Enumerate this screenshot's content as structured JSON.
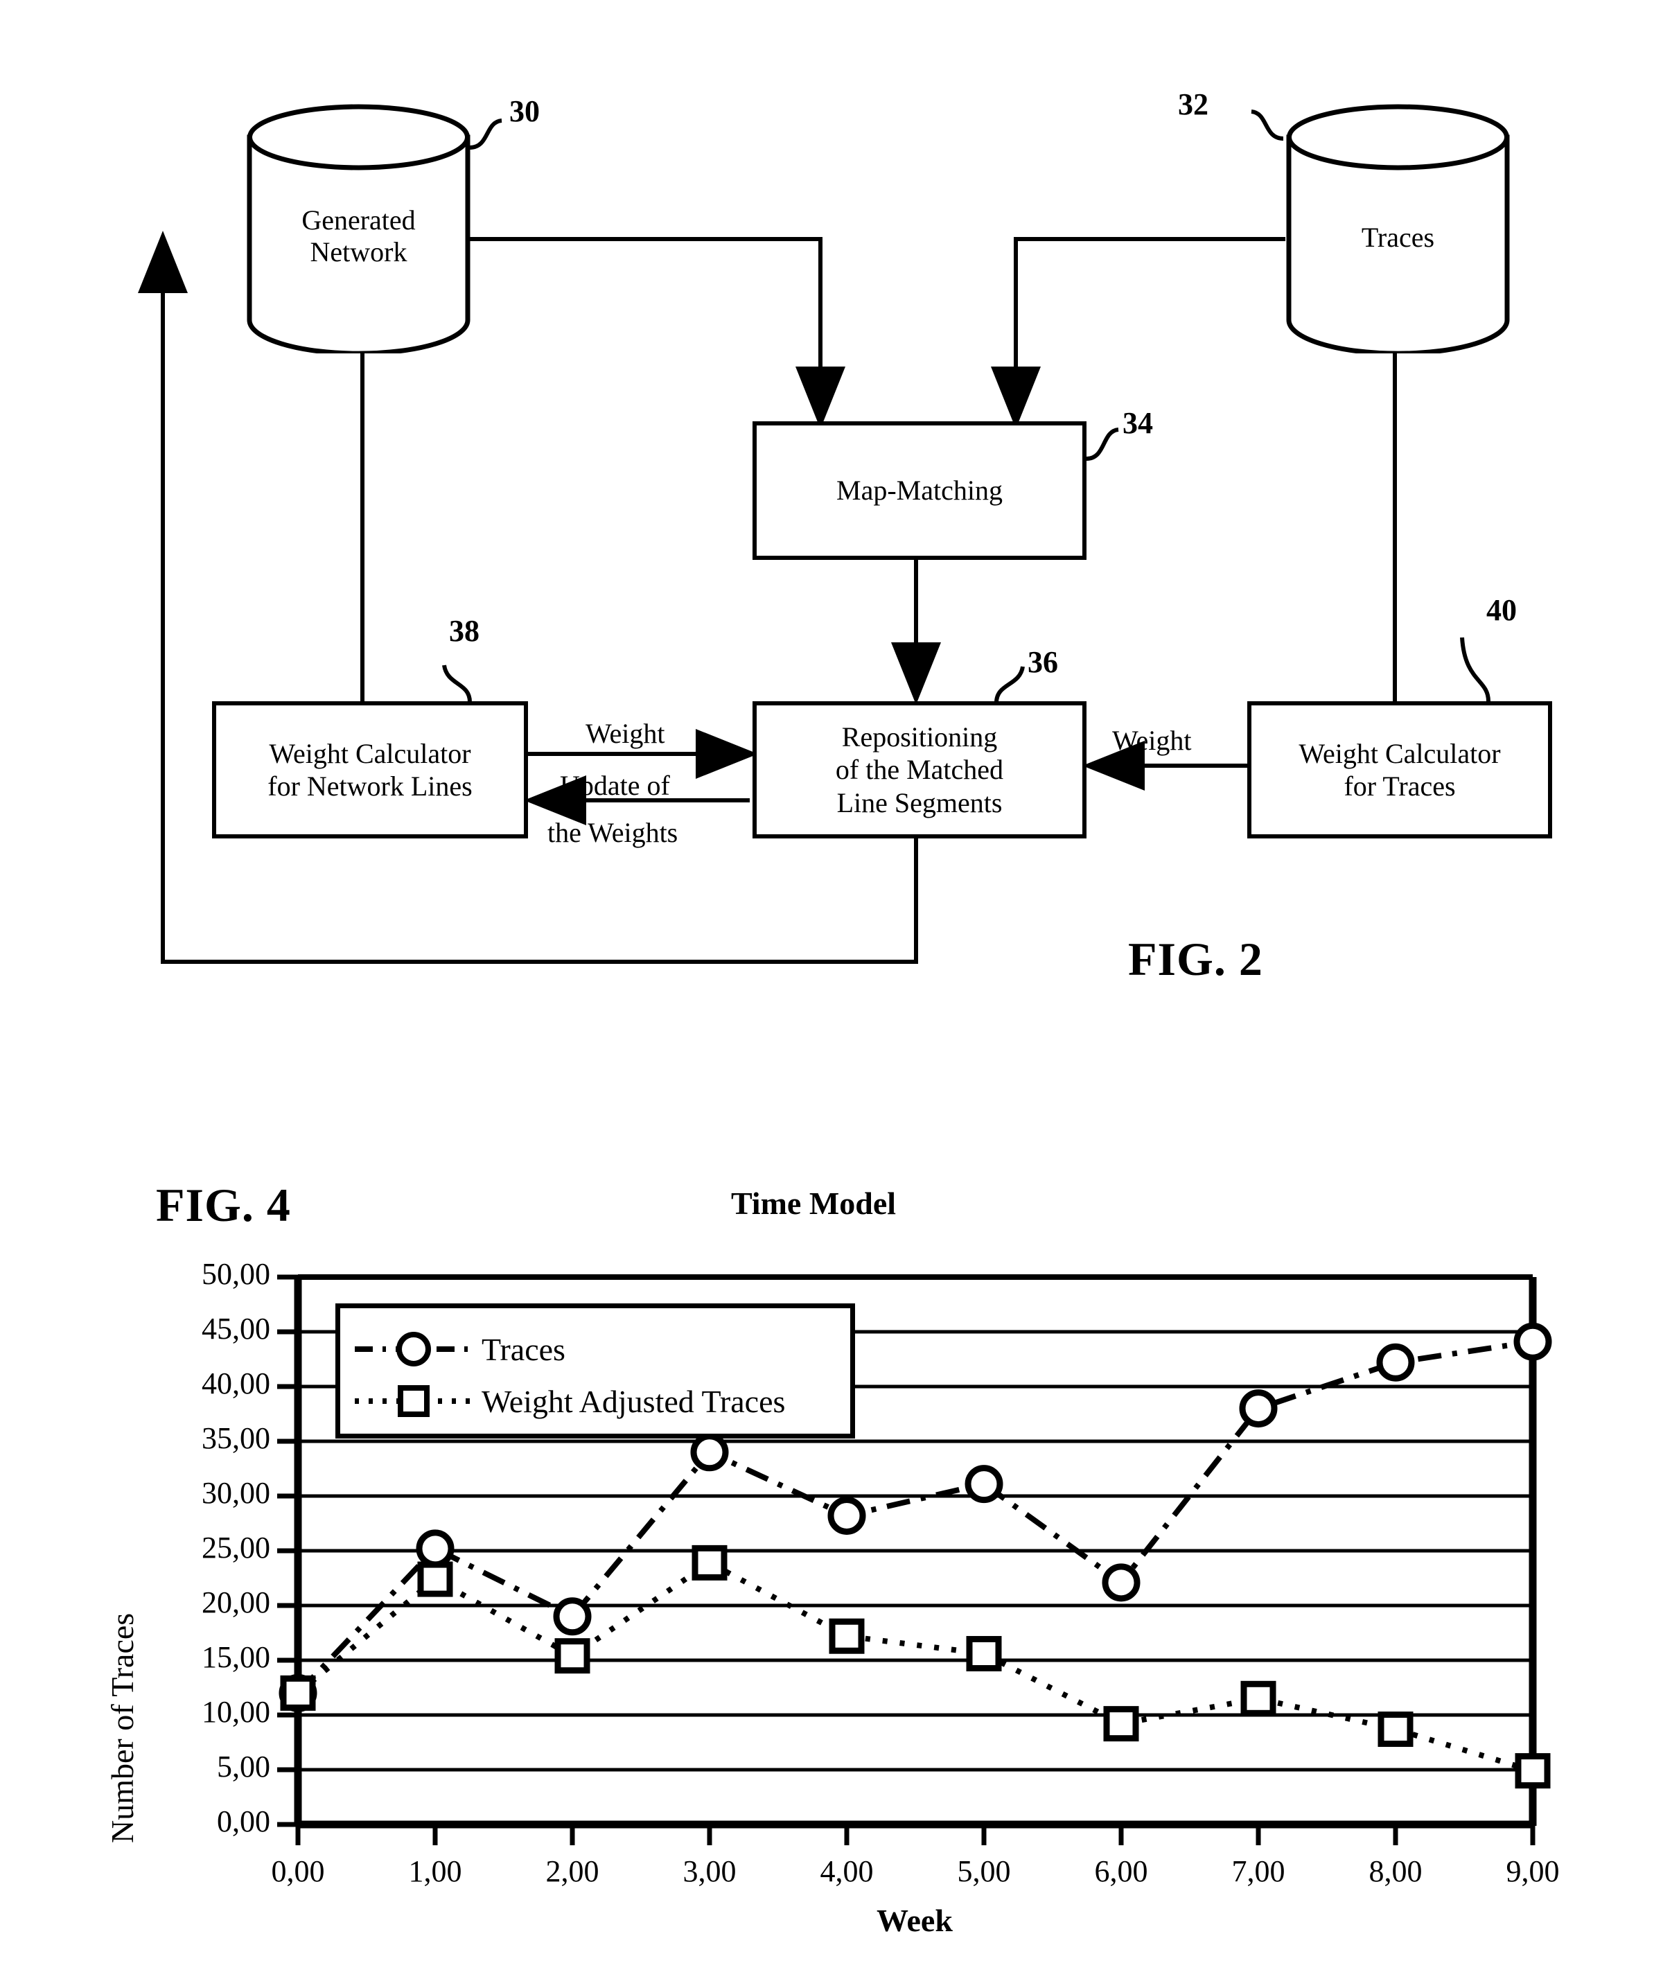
{
  "figure2": {
    "label": "FIG.  2",
    "nodes": [
      {
        "id": "generated_network",
        "type": "cylinder",
        "label": "Generated\nNetwork",
        "ref": "30"
      },
      {
        "id": "traces",
        "type": "cylinder",
        "label": "Traces",
        "ref": "32"
      },
      {
        "id": "map_matching",
        "type": "box",
        "label": "Map-Matching",
        "ref": "34"
      },
      {
        "id": "repositioning",
        "type": "box",
        "label": "Repositioning\nof the Matched\nLine Segments",
        "ref": "36"
      },
      {
        "id": "weight_calc_network",
        "type": "box",
        "label": "Weight Calculator\nfor Network Lines",
        "ref": "38"
      },
      {
        "id": "weight_calc_traces",
        "type": "box",
        "label": "Weight Calculator\nfor Traces",
        "ref": "40"
      }
    ],
    "edge_labels": {
      "weight_left": "Weight",
      "update_weights_line1": "Update of",
      "update_weights_line2": "the Weights",
      "weight_right": "Weight"
    }
  },
  "figure4": {
    "label": "FIG.  4"
  },
  "chart_data": {
    "type": "line",
    "title": "Time Model",
    "xlabel": "Week",
    "ylabel": "Number of Traces",
    "grid": true,
    "legend_position": "top-left-inside",
    "x": [
      0,
      1,
      2,
      3,
      4,
      5,
      6,
      7,
      8,
      9
    ],
    "xtick_labels": [
      "0,00",
      "1,00",
      "2,00",
      "3,00",
      "4,00",
      "5,00",
      "6,00",
      "7,00",
      "8,00",
      "9,00"
    ],
    "ytick_labels": [
      "0,00",
      "5,00",
      "10,00",
      "15,00",
      "20,00",
      "25,00",
      "30,00",
      "35,00",
      "40,00",
      "45,00",
      "50,00"
    ],
    "ytick_values": [
      0,
      5,
      10,
      15,
      20,
      25,
      30,
      35,
      40,
      45,
      50
    ],
    "ylim": [
      0,
      50
    ],
    "xlim": [
      0,
      9
    ],
    "series": [
      {
        "name": "Traces",
        "marker": "circle",
        "linestyle": "dash-dot",
        "values": [
          12.0,
          25.2,
          19.0,
          34.0,
          28.2,
          31.1,
          22.1,
          38.0,
          42.2,
          44.1
        ]
      },
      {
        "name": "Weight Adjusted Traces",
        "marker": "square",
        "linestyle": "dotted",
        "values": [
          12.0,
          22.4,
          15.4,
          23.9,
          17.2,
          15.6,
          9.2,
          11.5,
          8.7,
          4.9
        ]
      }
    ]
  }
}
